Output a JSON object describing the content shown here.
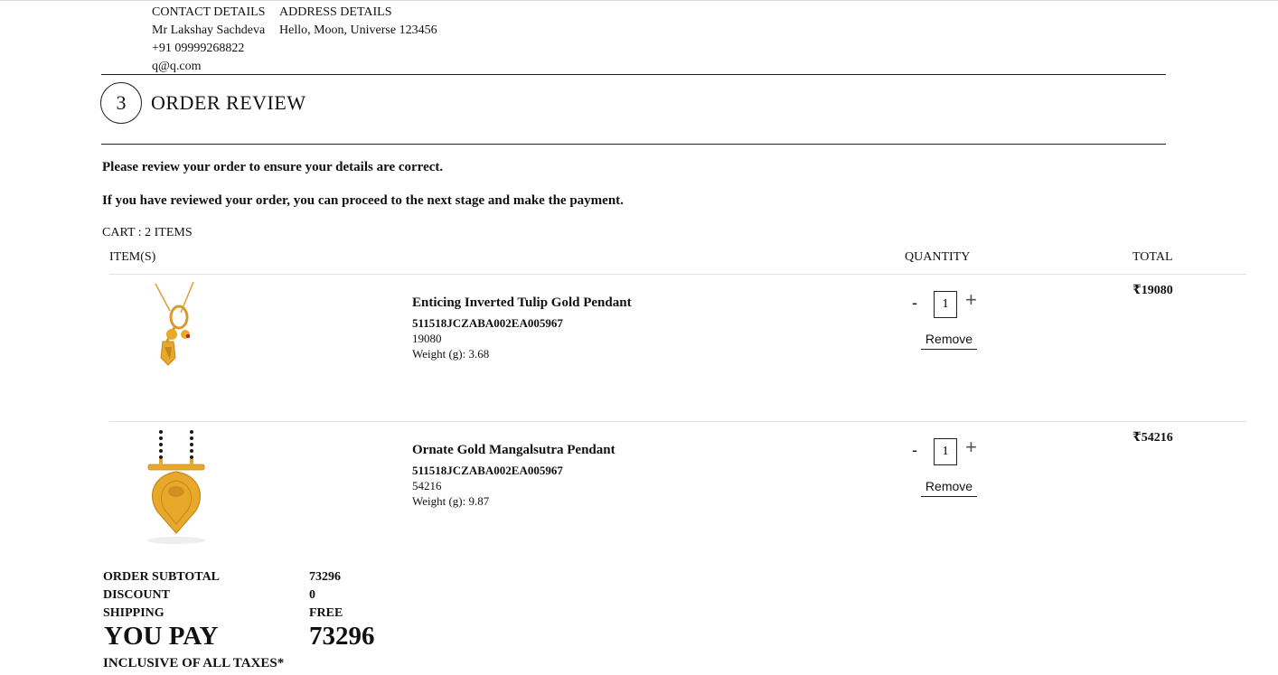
{
  "contact": {
    "heading": "CONTACT DETAILS",
    "name": "Mr Lakshay Sachdeva",
    "phone": "+91 09999268822",
    "email": "q@q.com"
  },
  "address": {
    "heading": "ADDRESS DETAILS",
    "line": "Hello, Moon, Universe 123456"
  },
  "step": {
    "number": "3",
    "title": "ORDER REVIEW"
  },
  "notes": {
    "review": "Please review your order to ensure your details are correct.",
    "proceed": "If you have reviewed your order, you can proceed to the next stage and make the payment."
  },
  "cart": {
    "count_label": "CART : 2 ITEMS",
    "headers": {
      "items": "ITEM(S)",
      "quantity": "QUANTITY",
      "total": "TOTAL"
    },
    "items": [
      {
        "name": "Enticing Inverted Tulip Gold Pendant",
        "sku": "511518JCZABA002EA005967",
        "price": "19080",
        "weight": "Weight (g): 3.68",
        "quantity": "1",
        "total": "₹19080",
        "remove_label": "Remove",
        "minus": "-",
        "plus": "+"
      },
      {
        "name": "Ornate Gold Mangalsutra Pendant",
        "sku": "511518JCZABA002EA005967",
        "price": "54216",
        "weight": "Weight (g): 9.87",
        "quantity": "1",
        "total": "₹54216",
        "remove_label": "Remove",
        "minus": "-",
        "plus": "+"
      }
    ]
  },
  "summary": {
    "subtotal_label": "ORDER SUBTOTAL",
    "subtotal_value": "73296",
    "discount_label": "DISCOUNT",
    "discount_value": "0",
    "shipping_label": "SHIPPING",
    "shipping_value": "FREE",
    "youpay_label": "YOU PAY",
    "youpay_value": "73296",
    "taxes_note": "INCLUSIVE OF ALL TAXES*"
  },
  "colors": {
    "gold": "#e8a92a",
    "gold_dark": "#c7861a",
    "accent_red": "#b3202a"
  }
}
